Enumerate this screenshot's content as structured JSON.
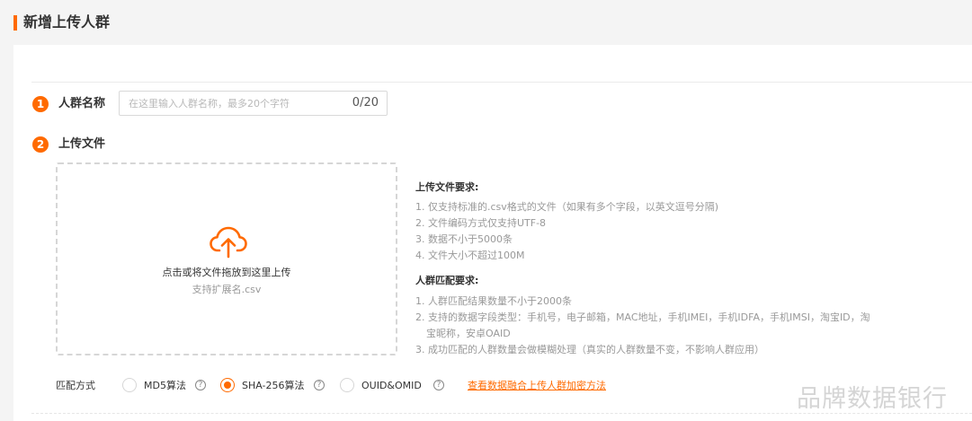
{
  "page": {
    "title": "新增上传人群"
  },
  "step1": {
    "number": "1",
    "label": "人群名称",
    "input_placeholder": "在这里输入人群名称，最多20个字符",
    "input_value": "",
    "char_count": "0/20"
  },
  "step2": {
    "number": "2",
    "label": "上传文件",
    "upload": {
      "icon": "cloud-upload-icon",
      "main_text": "点击或将文件拖放到这里上传",
      "sub_text": "支持扩展名.csv"
    },
    "file_requirements": {
      "title": "上传文件要求:",
      "items": [
        "1. 仅支持标准的.csv格式的文件（如果有多个字段，以英文逗号分隔)",
        "2. 文件编码方式仅支持UTF-8",
        "3. 数据不小于5000条",
        "4. 文件大小不超过100M"
      ]
    },
    "match_requirements": {
      "title": "人群匹配要求:",
      "items": [
        "1. 人群匹配结果数量不小于2000条",
        "2. 支持的数据字段类型：手机号，电子邮箱，MAC地址，手机IMEI，手机IDFA，手机IMSI，淘宝ID，淘",
        "宝昵称，安卓OAID",
        "3. 成功匹配的人群数量会做模糊处理（真实的人群数量不变，不影响人群应用）"
      ]
    }
  },
  "match_method": {
    "label": "匹配方式",
    "options": [
      {
        "label": "MD5算法",
        "selected": false
      },
      {
        "label": "SHA-256算法",
        "selected": true
      },
      {
        "label": "OUID&OMID",
        "selected": false
      }
    ],
    "help_glyph": "?",
    "link_text": "查看数据融合上传人群加密方法"
  },
  "watermark": "品牌数据银行",
  "colors": {
    "accent": "#ff6a00",
    "muted_text": "#999999",
    "border": "#d9d9d9"
  }
}
